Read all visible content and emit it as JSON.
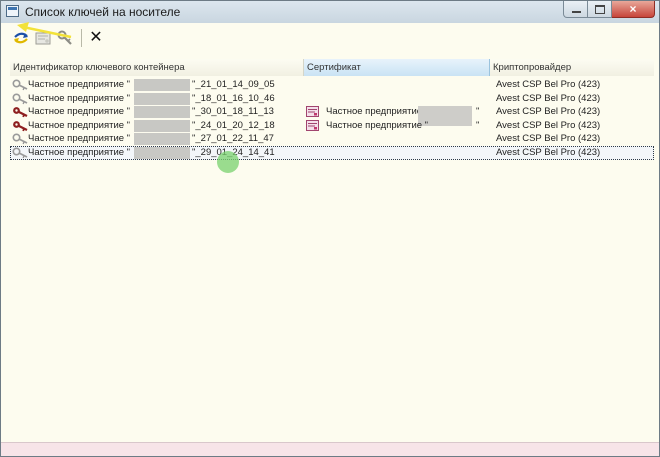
{
  "window": {
    "title": "Список ключей на носителе",
    "controls": {
      "close_glyph": "×"
    }
  },
  "toolbar": {
    "buttons": [
      {
        "name": "refresh-icon"
      },
      {
        "name": "certificate-icon"
      },
      {
        "name": "key-tool-icon"
      },
      {
        "name": "delete-icon",
        "glyph": "✕"
      }
    ]
  },
  "columns": {
    "container_id": "Идентификатор ключевого контейнера",
    "certificate": "Сертификат",
    "provider": "Криптопровайдер"
  },
  "rows": [
    {
      "id_prefix": "Частное предприятие \"",
      "id_suffix": "\"_21_01_14_09_05",
      "key_icon": "key-gray-icon",
      "cert_label": "",
      "cert_quote": "",
      "provider": "Avest CSP Bel Pro (423)"
    },
    {
      "id_prefix": "Частное предприятие \"",
      "id_suffix": "\"_18_01_16_10_46",
      "key_icon": "key-gray-icon",
      "cert_label": "",
      "cert_quote": "",
      "provider": "Avest CSP Bel Pro (423)"
    },
    {
      "id_prefix": "Частное предприятие \"",
      "id_suffix": "\"_30_01_18_11_13",
      "key_icon": "key-red-icon",
      "cert_label": "Частное предприятие \"",
      "cert_quote": "\"",
      "provider": "Avest CSP Bel Pro (423)"
    },
    {
      "id_prefix": "Частное предприятие \"",
      "id_suffix": "\"_24_01_20_12_18",
      "key_icon": "key-red-icon",
      "cert_label": "Частное предприятие \"",
      "cert_quote": "\"",
      "provider": "Avest CSP Bel Pro (423)"
    },
    {
      "id_prefix": "Частное предприятие \"",
      "id_suffix": "\"_27_01_22_11_47",
      "key_icon": "key-gray-icon",
      "cert_label": "",
      "cert_quote": "",
      "provider": "Avest CSP Bel Pro (423)"
    },
    {
      "id_prefix": "Частное предприятие \"",
      "id_suffix": "\"_29_01_24_14_41",
      "key_icon": "key-gray-icon",
      "cert_label": "",
      "cert_quote": "",
      "provider": "Avest CSP Bel Pro (423)",
      "selected": true
    }
  ],
  "colors": {
    "window_bg": "#fdfcef",
    "sorted_header": "#c9e3f4",
    "cursor_highlight": "#78d26e",
    "annotation_arrow": "#f2e23a",
    "key_red": "#8e1f1f",
    "key_gray": "#9a9a9a"
  }
}
